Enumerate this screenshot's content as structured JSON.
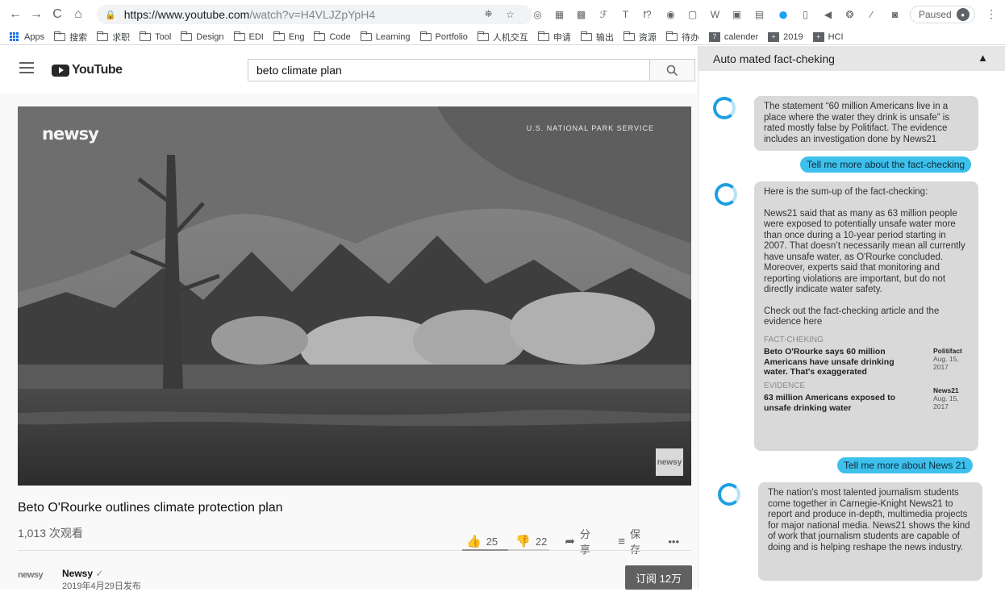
{
  "browser": {
    "url_host": "https://www.youtube.com",
    "url_path": "/watch?v=H4VLJZpYpH4",
    "paused_label": "Paused",
    "nav": [
      "←",
      "→",
      "C",
      "⌂"
    ],
    "extensions": [
      "⛯",
      "☆",
      "◎",
      "▦",
      "▩",
      "ℱ",
      "T",
      "f?",
      "◉",
      "▢",
      "W",
      "▣",
      "▤",
      "●",
      "▯",
      "◀",
      "❂",
      "∕",
      "◙"
    ]
  },
  "bookmarks": [
    {
      "label": "Apps",
      "icon": "apps-grid"
    },
    {
      "label": "搜索",
      "icon": "folder"
    },
    {
      "label": "求职",
      "icon": "folder"
    },
    {
      "label": "Tool",
      "icon": "folder"
    },
    {
      "label": "Design",
      "icon": "folder"
    },
    {
      "label": "EDI",
      "icon": "folder"
    },
    {
      "label": "Eng",
      "icon": "folder"
    },
    {
      "label": "Code",
      "icon": "folder"
    },
    {
      "label": "Learning",
      "icon": "folder"
    },
    {
      "label": "Portfolio",
      "icon": "folder"
    },
    {
      "label": "人机交互",
      "icon": "folder"
    },
    {
      "label": "申请",
      "icon": "folder"
    },
    {
      "label": "输出",
      "icon": "folder"
    },
    {
      "label": "资源",
      "icon": "folder"
    },
    {
      "label": "待办",
      "icon": "folder"
    },
    {
      "label": "calender",
      "icon": "calendar"
    },
    {
      "label": "2019",
      "icon": "plus-square"
    },
    {
      "label": "HCI",
      "icon": "plus-square"
    }
  ],
  "youtube": {
    "logo_text": "YouTube",
    "search_value": "beto climate plan",
    "watermark_left": "newsy",
    "watermark_right": "U.S. NATIONAL PARK SERVICE",
    "corner_logo": "newsy",
    "video_title": "Beto O'Rourke outlines climate protection plan",
    "views": "1,013 次观看",
    "likes": "25",
    "dislikes": "22",
    "share_label": "分享",
    "save_label": "保存",
    "more_label": "•••",
    "like_ratio": 0.53,
    "channel_logo_text": "newsy",
    "channel_name": "Newsy",
    "publish_date": "2019年4月29日发布",
    "subscribe_label": "订阅 12万"
  },
  "chat": {
    "header": "Auto mated fact-cheking",
    "msg1": "The statement “60 million Americans live in a place where the water they drink is unsafe” is rated mostly false by Politifact. The evidence includes an investigation done by News21",
    "user1": "Tell me more about the fact-checking",
    "msg2_intro": "Here is the sum-up of the fact-checking:",
    "msg2_body": "News21 said that as many as 63 million people were exposed to potentially unsafe water more than once during a 10-year period starting in 2007. That doesn’t necessarily mean all currently have unsafe water, as O'Rourke concluded. Moreover, experts said that monitoring and reporting violations are important, but do not directly indicate water safety.",
    "msg2_cta": "Check out the fact-checking article and the evidence here",
    "fact_label": "FACT-CHEKING",
    "fact_title": "Beto O'Rourke says 60 million Americans have unsafe drinking water. That's exaggerated",
    "fact_source": "Politifact",
    "fact_date": "Aug. 15, 2017",
    "evidence_label": "EVIDENCE",
    "evidence_title": "63 million Americans exposed to unsafe drinking water",
    "evidence_source": "News21",
    "evidence_date": "Aug. 15, 2017",
    "user2": "Tell me more about News 21",
    "msg3": "The nation's most talented journalism students come together in Carnegie-Knight News21 to report and produce in-depth, multimedia projects for major national media. News21 shows the kind of work that journalism students are capable of doing and is helping reshape the news industry."
  }
}
